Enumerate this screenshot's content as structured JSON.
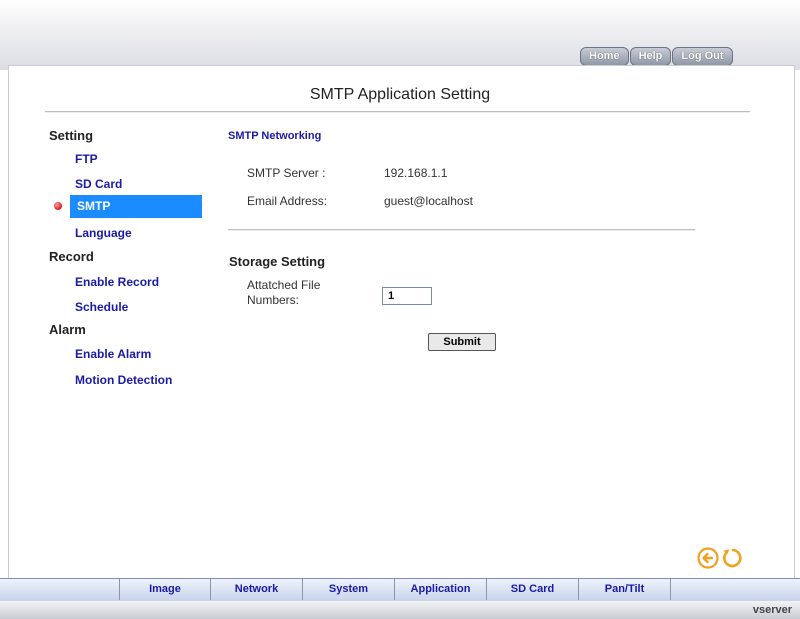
{
  "top_nav": {
    "home": "Home",
    "help": "Help",
    "logout": "Log Out"
  },
  "page_title": "SMTP Application Setting",
  "sidebar": {
    "setting": {
      "heading": "Setting",
      "items": [
        "FTP",
        "SD Card",
        "SMTP",
        "Language"
      ],
      "active": "SMTP"
    },
    "record": {
      "heading": "Record",
      "items": [
        "Enable Record",
        "Schedule"
      ]
    },
    "alarm": {
      "heading": "Alarm",
      "items": [
        "Enable Alarm",
        "Motion Detection"
      ]
    }
  },
  "smtp": {
    "heading": "SMTP Networking",
    "server_label": "SMTP Server :",
    "server_value": "192.168.1.1",
    "email_label": "Email Address:",
    "email_value": "guest@localhost"
  },
  "storage": {
    "heading": "Storage Setting",
    "attach_label": "Attatched File Numbers:",
    "attach_value": "1",
    "submit_label": "Submit"
  },
  "icons": {
    "back": "back-arrow-icon",
    "refresh": "refresh-icon",
    "accent": "#f0a020"
  },
  "tabs": [
    "Image",
    "Network",
    "System",
    "Application",
    "SD Card",
    "Pan/Tilt"
  ],
  "footer_brand": "vserver"
}
